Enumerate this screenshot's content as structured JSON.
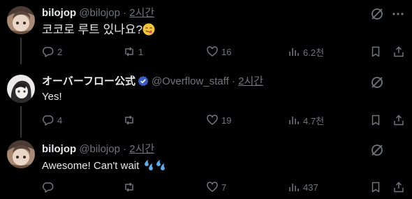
{
  "tweets": [
    {
      "name": "bilojop",
      "handle": "@bilojop",
      "separator": "·",
      "time": "2시간",
      "text": "코코로 루트 있나요?",
      "emoji": "😋",
      "replies": "2",
      "reposts": "1",
      "likes": "16",
      "views": "6.2천"
    },
    {
      "name": "オーバーフロー公式",
      "handle": "@Overflow_staff",
      "separator": "·",
      "time": "2시간",
      "text": "Yes!",
      "replies": "4",
      "reposts": "",
      "likes": "19",
      "views": "4.7천"
    },
    {
      "name": "bilojop",
      "handle": "@bilojop",
      "separator": "·",
      "time": "2시간",
      "text": "Awesome! Can't wait",
      "emoji": "💦💦",
      "replies": "",
      "reposts": "",
      "likes": "7",
      "views": "437"
    }
  ],
  "colors": {
    "background": "#000000",
    "text": "#e7e9ea",
    "secondary": "#71767b",
    "thread_line": "#333639",
    "verified_badge": "#3b5ec2"
  }
}
